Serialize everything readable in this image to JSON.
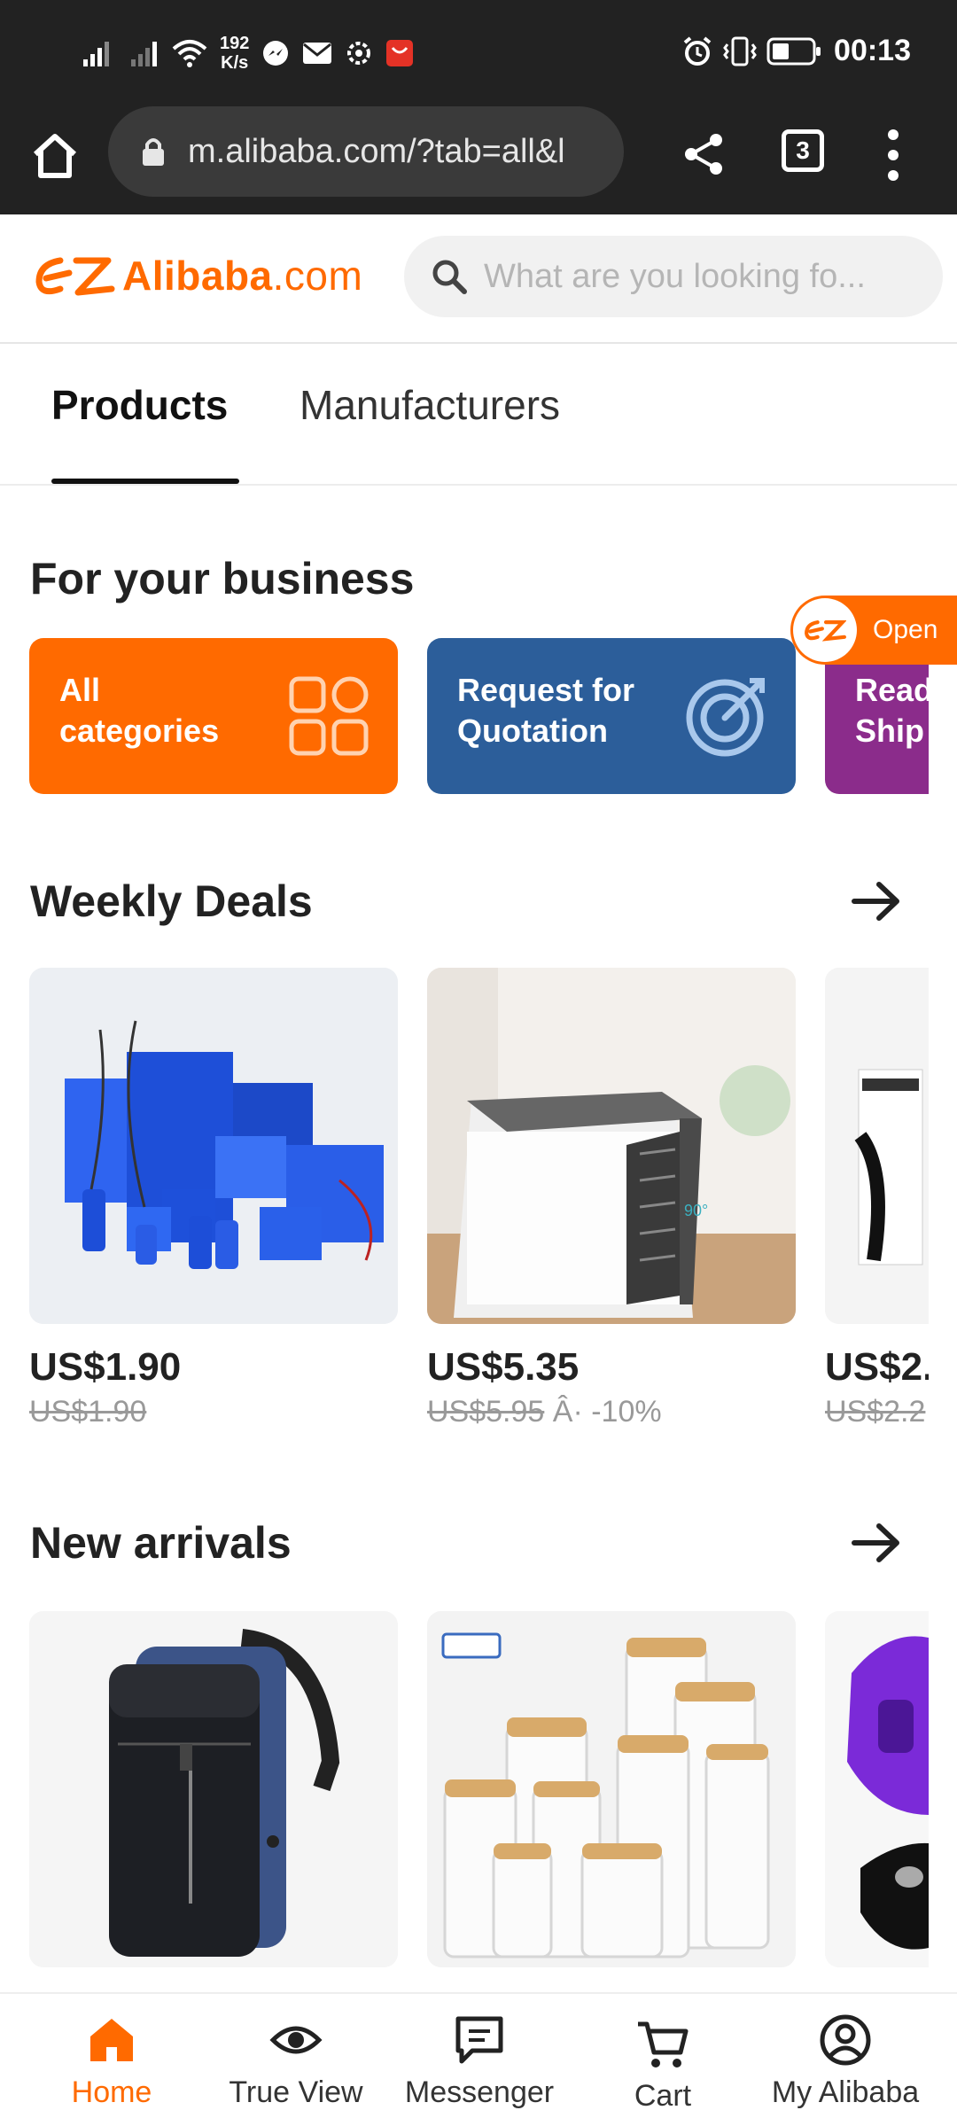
{
  "status_bar": {
    "speed_value": "192",
    "speed_unit": "K/s",
    "time": "00:13"
  },
  "browser": {
    "url": "m.alibaba.com/?tab=all&l",
    "tab_count": "3"
  },
  "header": {
    "logo_text": "Alibaba",
    "logo_suffix": ".com",
    "search_placeholder": "What are you looking fo..."
  },
  "tabs": [
    {
      "label": "Products",
      "active": true
    },
    {
      "label": "Manufacturers",
      "active": false
    }
  ],
  "business": {
    "title": "For your business",
    "cards": [
      {
        "line1": "All",
        "line2": "categories",
        "icon": "grid-icon",
        "color": "#ff6a00"
      },
      {
        "line1": "Request for",
        "line2": "Quotation",
        "icon": "target-icon",
        "color": "#2c5e9a"
      },
      {
        "line1": "Read",
        "line2": "Ship",
        "color": "#8b2c8b"
      }
    ],
    "open_badge": "Open"
  },
  "weekly_deals": {
    "title": "Weekly Deals",
    "items": [
      {
        "image": "lithium-battery-packs",
        "price": "US$1.90",
        "old_price": "US$1.90",
        "discount": ""
      },
      {
        "image": "mini-air-cooler",
        "price": "US$5.35",
        "old_price": "US$5.95",
        "discount": "Â· -10%"
      },
      {
        "image": "slimming-cream-box",
        "price": "US$2.",
        "old_price": "US$2.2",
        "discount": ""
      }
    ]
  },
  "new_arrivals": {
    "title": "New arrivals",
    "items": [
      {
        "image": "laptop-backpack"
      },
      {
        "image": "glass-storage-jars"
      },
      {
        "image": "jaw-exerciser"
      }
    ]
  },
  "bottom_nav": [
    {
      "label": "Home",
      "icon": "home-icon",
      "active": true
    },
    {
      "label": "True View",
      "icon": "eye-icon",
      "active": false
    },
    {
      "label": "Messenger",
      "icon": "chat-icon",
      "active": false
    },
    {
      "label": "Cart",
      "icon": "cart-icon",
      "active": false
    },
    {
      "label": "My Alibaba",
      "icon": "user-icon",
      "active": false
    }
  ],
  "colors": {
    "brand_orange": "#ff6a00",
    "quotation_blue": "#2c5e9a",
    "ready_ship_purple": "#8b2c8b",
    "browser_chrome": "#222222"
  }
}
